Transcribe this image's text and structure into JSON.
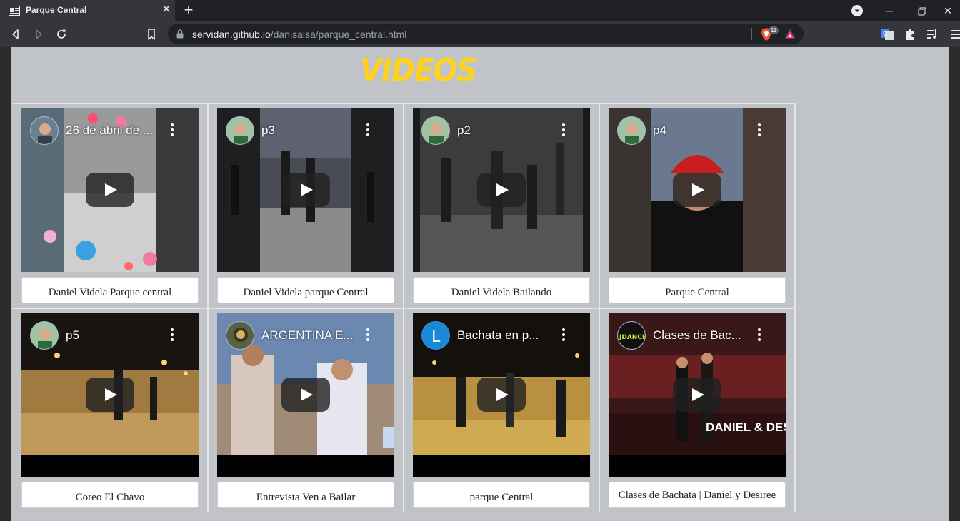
{
  "browser": {
    "tab": {
      "title": "Parque Central"
    },
    "url": {
      "host": "servidan.github.io",
      "path": "/danisalsa/parque_central.html"
    },
    "shield_count": "11",
    "colors": {
      "frame": "#202124",
      "toolbar": "#35363a",
      "omnibox": "#202124"
    }
  },
  "page": {
    "heading": "VIDEOS",
    "colors": {
      "background": "#c0c4c8",
      "heading": "#ffd21f"
    },
    "videos": [
      {
        "title": "26 de abril de ...",
        "caption": "Daniel Videla Parque central",
        "avatar": "profile-photo"
      },
      {
        "title": "p3",
        "caption": "Daniel Videla parque Central",
        "avatar": "profile-photo"
      },
      {
        "title": "p2",
        "caption": "Daniel Videla Bailando",
        "avatar": "profile-photo"
      },
      {
        "title": "p4",
        "caption": "Parque Central",
        "avatar": "profile-photo"
      },
      {
        "title": "p5",
        "caption": "Coreo El Chavo",
        "avatar": "profile-photo"
      },
      {
        "title": "ARGENTINA E...",
        "caption": "Entrevista Ven a Bailar",
        "avatar": "profile-photo"
      },
      {
        "title": "Bachata en p...",
        "caption": "parque Central",
        "avatar": "L"
      },
      {
        "title": "Clases de Bac...",
        "caption": "Clases de Bachata | Daniel y Desiree",
        "avatar": "JDANCE"
      }
    ],
    "thumb_texts": {
      "overlay_8": "DANIEL & DESIRE"
    }
  }
}
